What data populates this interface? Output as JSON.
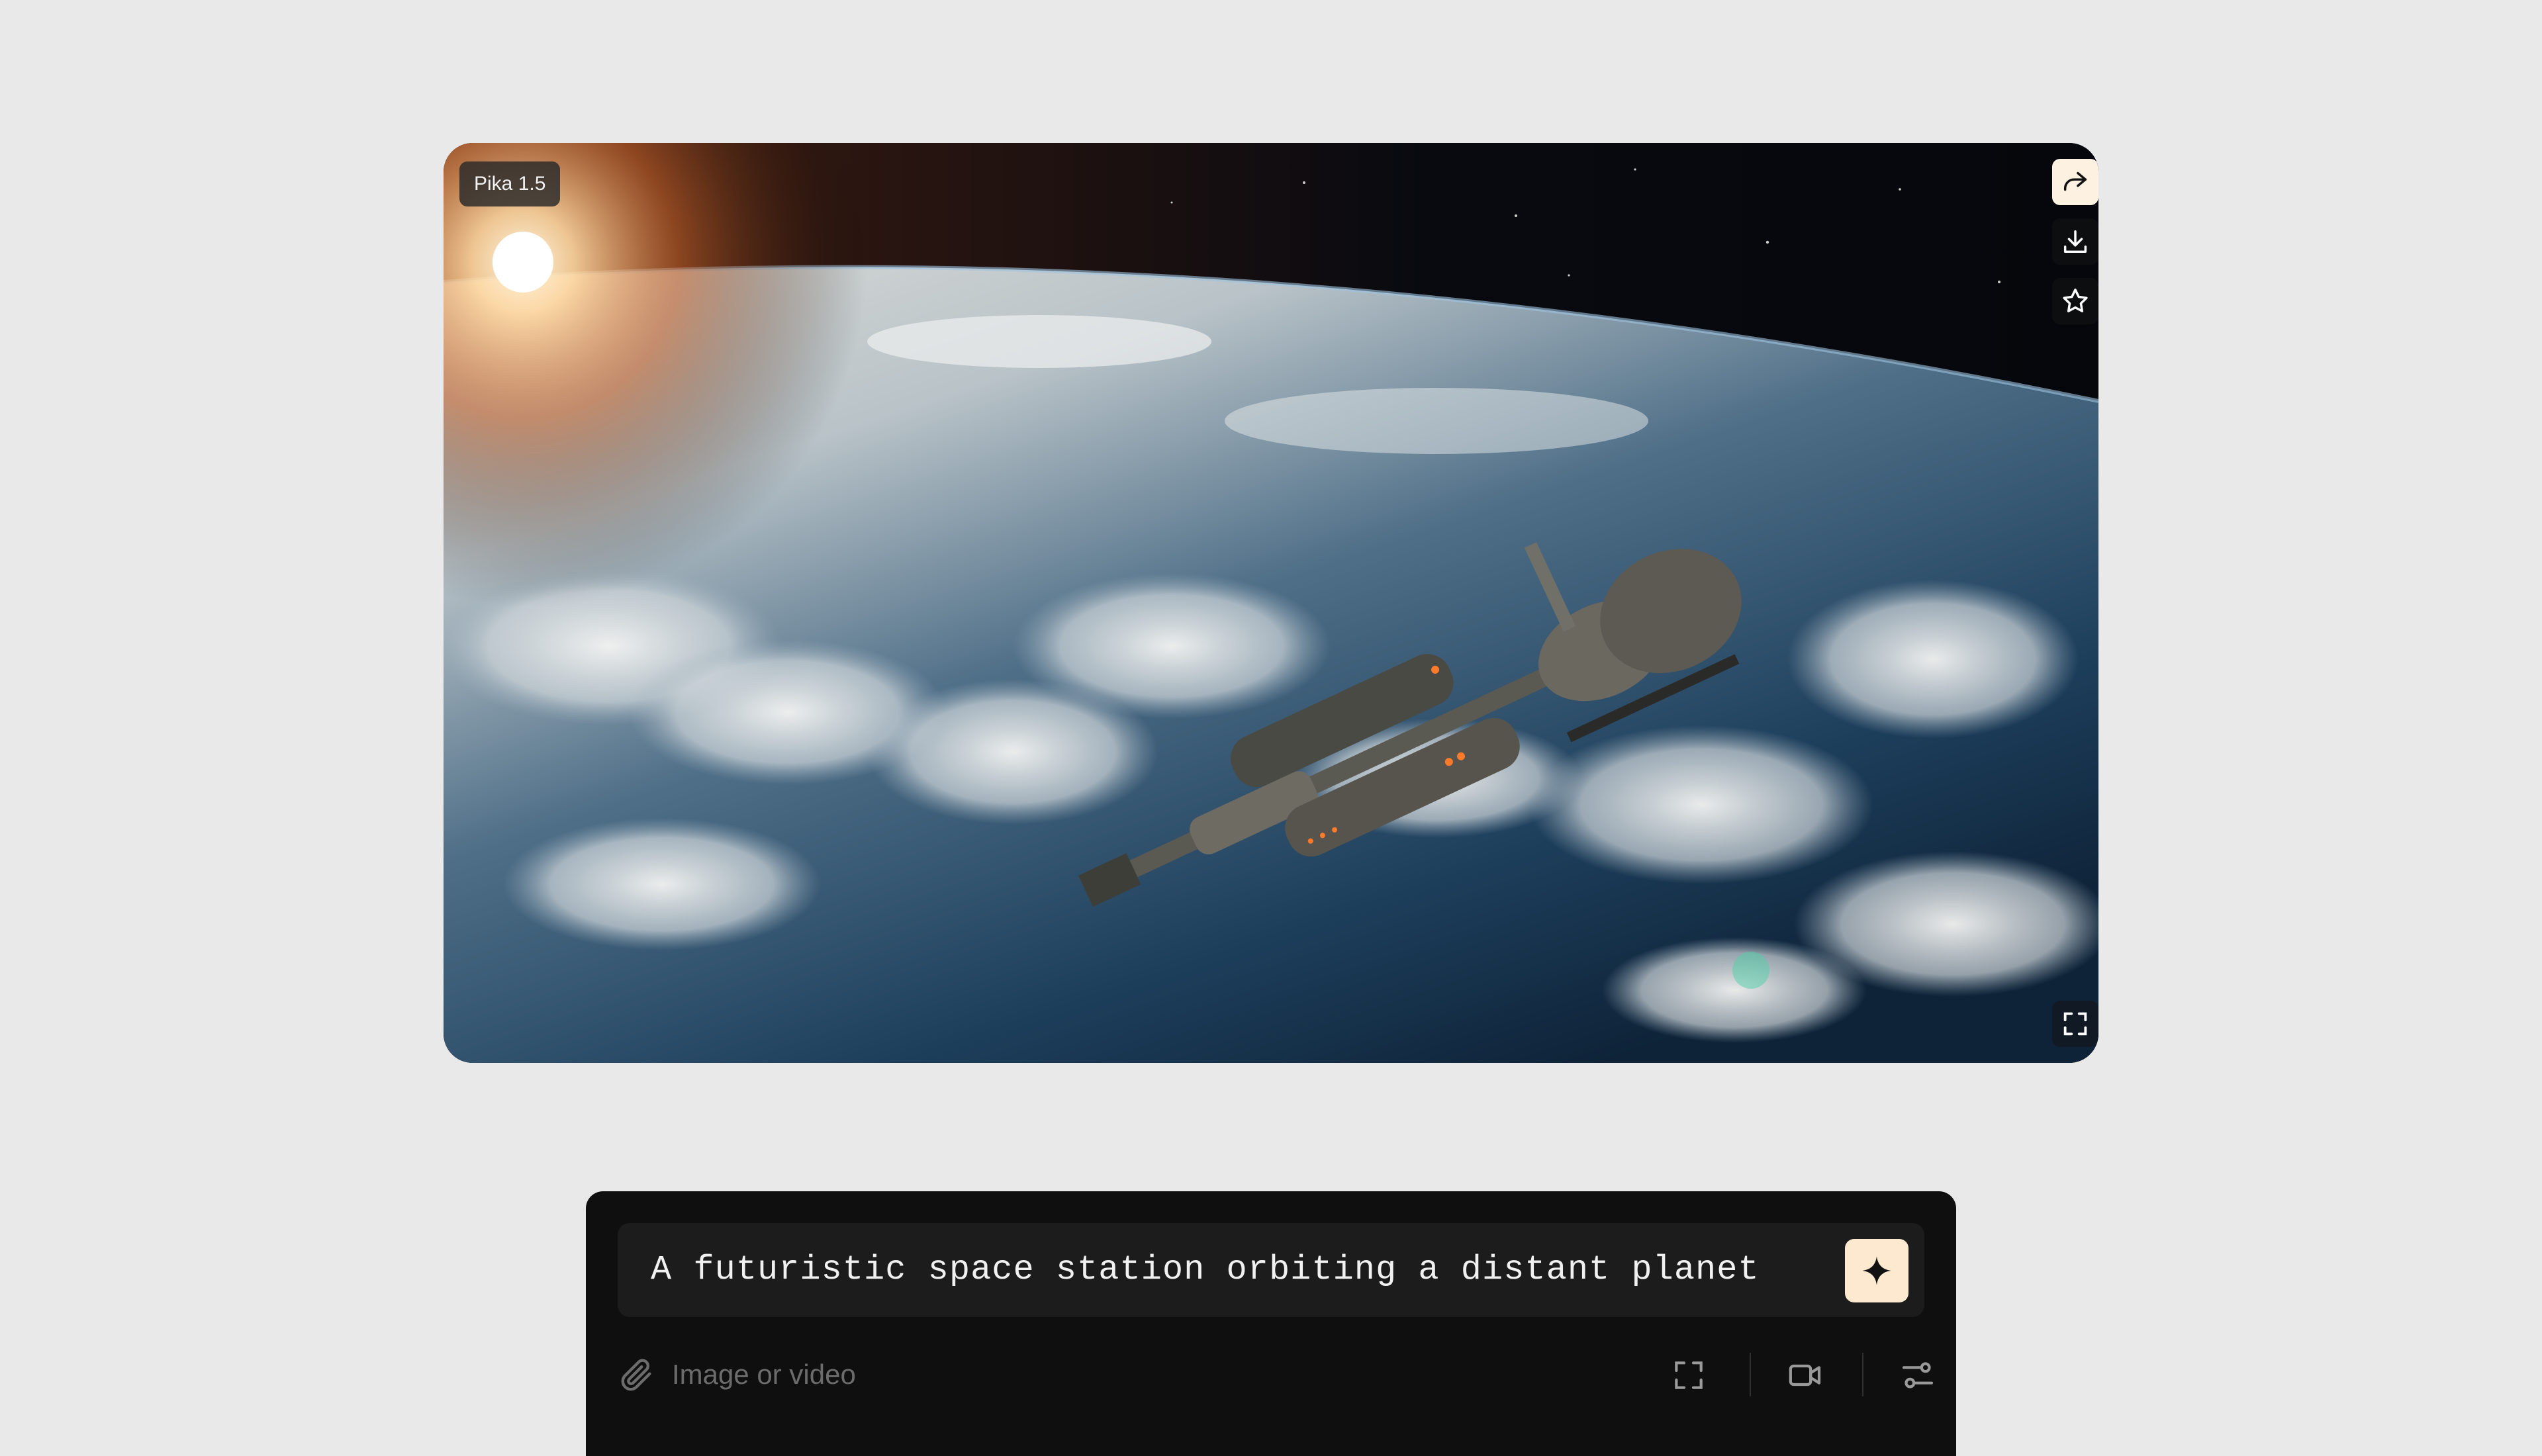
{
  "video": {
    "model_badge": "Pika 1.5",
    "actions": [
      {
        "name": "share-icon"
      },
      {
        "name": "download-icon"
      },
      {
        "name": "star-icon"
      }
    ],
    "fullscreen_icon": "fullscreen-icon"
  },
  "prompt": {
    "text": "A futuristic space station orbiting a distant planet",
    "generate_icon": "sparkle-icon"
  },
  "toolbar": {
    "attach_icon": "paperclip-icon",
    "attach_placeholder": "Image or video",
    "tools": [
      "aspect-ratio-icon",
      "video-camera-icon",
      "settings-sliders-icon"
    ]
  },
  "colors": {
    "background": "#e9e9e9",
    "panel": "#0f0f0f",
    "accent": "#fde9cf"
  }
}
